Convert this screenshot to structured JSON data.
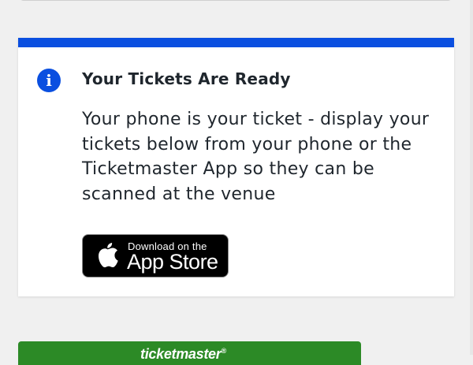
{
  "notice": {
    "icon": "info-icon",
    "icon_glyph": "i",
    "title": "Your Tickets Are Ready",
    "body": "Your phone is your ticket - display your tickets below from your phone or the Ticketmaster App so they can be scanned at the venue",
    "accent_color": "#0a4fe0"
  },
  "app_store_badge": {
    "icon": "apple-icon",
    "small_text": "Download on the",
    "large_text": "App Store"
  },
  "ticket_header": {
    "logo_text": "ticketmaster",
    "logo_mark": "®",
    "color": "#2c8a26"
  }
}
